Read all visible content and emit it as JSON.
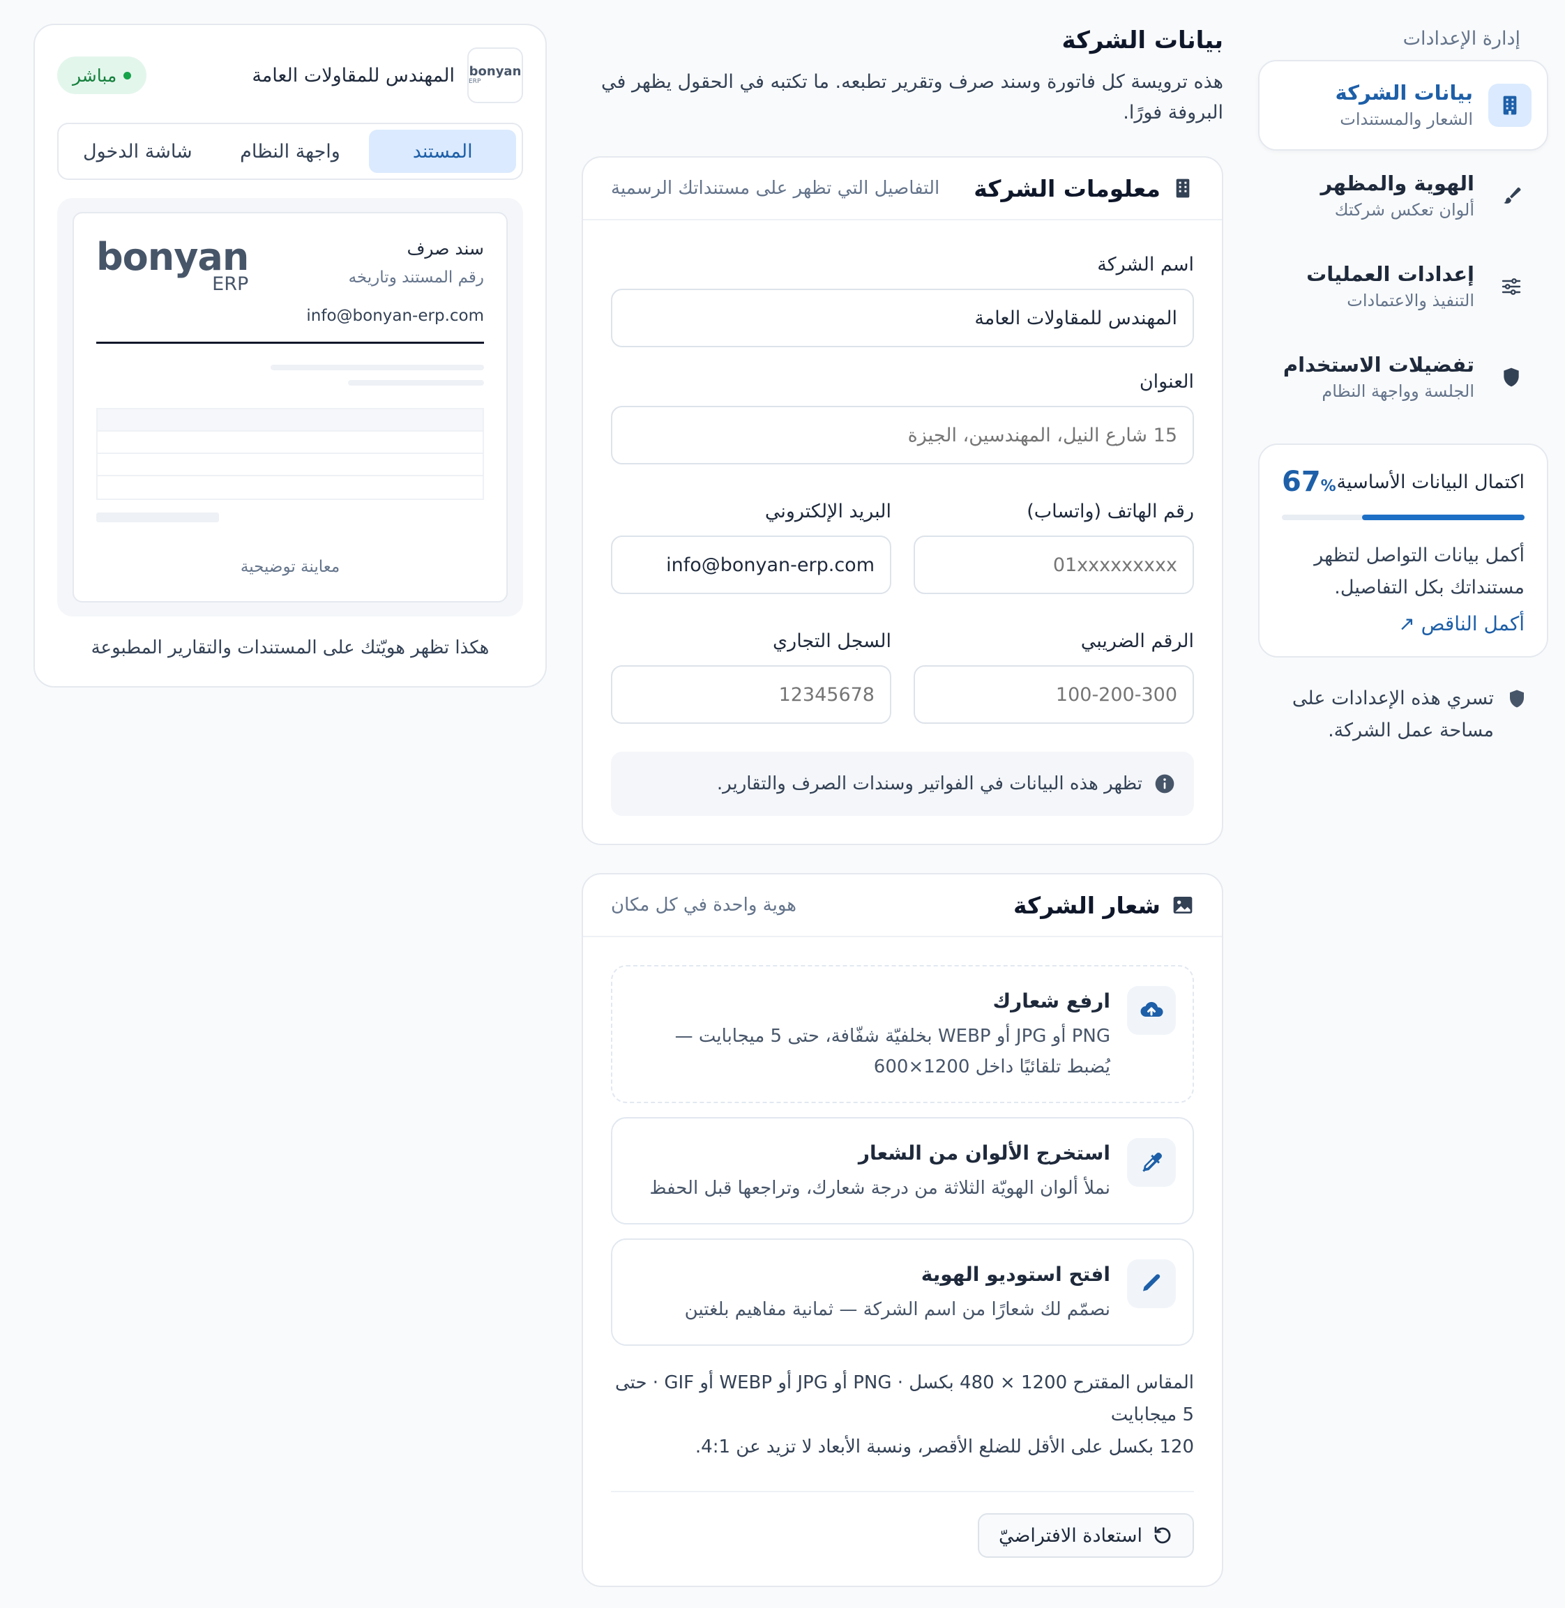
{
  "sidebar": {
    "heading": "إدارة الإعدادات",
    "items": [
      {
        "title": "بيانات الشركة",
        "subtitle": "الشعار والمستندات",
        "icon": "building-icon",
        "active": true
      },
      {
        "title": "الهوية والمظهر",
        "subtitle": "ألوان تعكس شركتك",
        "icon": "brush-icon"
      },
      {
        "title": "إعدادات العمليات",
        "subtitle": "التنفيذ والاعتمادات",
        "icon": "sliders-icon"
      },
      {
        "title": "تفضيلات الاستخدام",
        "subtitle": "الجلسة وواجهة النظام",
        "icon": "shield-icon"
      }
    ],
    "progress": {
      "title": "اكتمال البيانات الأساسية",
      "percent": 67,
      "percent_value": "67",
      "percent_sign": "%",
      "text": "أكمل بيانات التواصل لتظهر مستنداتك بكل التفاصيل.",
      "link": "أكمل الناقص ↗"
    },
    "note": "تسري هذه الإعدادات على مساحة عمل الشركة."
  },
  "main": {
    "title": "بيانات الشركة",
    "description": "هذه ترويسة كل فاتورة وسند صرف وتقرير تطبعه. ما تكتبه في الحقول يظهر في البروفة فورًا.",
    "info_card": {
      "title": "معلومات الشركة",
      "subtitle": "التفاصيل التي تظهر على مستنداتك الرسمية",
      "fields": {
        "company_name": {
          "label": "اسم الشركة",
          "value": "المهندس للمقاولات العامة"
        },
        "address": {
          "label": "العنوان",
          "placeholder": "15 شارع النيل، المهندسين، الجيزة"
        },
        "phone": {
          "label": "رقم الهاتف (واتساب)",
          "placeholder": "01xxxxxxxxx"
        },
        "email": {
          "label": "البريد الإلكتروني",
          "value": "info@bonyan-erp.com"
        },
        "tax_number": {
          "label": "الرقم الضريبي",
          "placeholder": "100-200-300"
        },
        "commercial_register": {
          "label": "السجل التجاري",
          "placeholder": "12345678"
        }
      },
      "info_note": "تظهر هذه البيانات في الفواتير وسندات الصرف والتقارير."
    },
    "logo_card": {
      "title": "شعار الشركة",
      "subtitle": "هوية واحدة في كل مكان",
      "options": [
        {
          "title": "ارفع شعارك",
          "desc": "PNG أو JPG أو WEBP بخلفيّة شفّافة، حتى 5 ميجابايت — يُضبط تلقائيًا داخل 1200×600",
          "icon": "cloud-upload-icon"
        },
        {
          "title": "استخرج الألوان من الشعار",
          "desc": "نملأ ألوان الهويّة الثلاثة من درجة شعارك، وتراجعها قبل الحفظ",
          "icon": "eyedropper-icon"
        },
        {
          "title": "افتح استوديو الهوية",
          "desc": "نصمّم لك شعارًا من اسم الشركة — ثمانية مفاهيم بلغتين",
          "icon": "pencil-icon"
        }
      ],
      "size_note_1": "المقاس المقترح 1200 × 480 بكسل · PNG أو JPG أو WEBP أو GIF · حتى 5 ميجابايت",
      "size_note_2": "120 بكسل على الأقل للضلع الأقصر، ونسبة الأبعاد لا تزيد عن 4:1.",
      "reset_label": "استعادة الافتراضيّ"
    }
  },
  "preview": {
    "logo_word": "bonyan",
    "logo_sub": "ERP",
    "company_name": "المهندس للمقاولات العامة",
    "badge": "مباشر",
    "tabs": [
      {
        "label": "المستند",
        "active": true
      },
      {
        "label": "واجهة النظام"
      },
      {
        "label": "شاشة الدخول"
      }
    ],
    "paper": {
      "doc_title": "سند صرف",
      "doc_subtitle": "رقم المستند وتاريخه",
      "logo_word": "bonyan",
      "logo_sub": "ERP",
      "email": "info@bonyan-erp.com",
      "caption": "معاينة توضيحية"
    },
    "footer": "هكذا تظهر هويّتك على المستندات والتقارير المطبوعة"
  },
  "colors": {
    "accent": "#1d5fa8",
    "accent_bg": "#dbeafe",
    "live_green": "#16a34a"
  }
}
